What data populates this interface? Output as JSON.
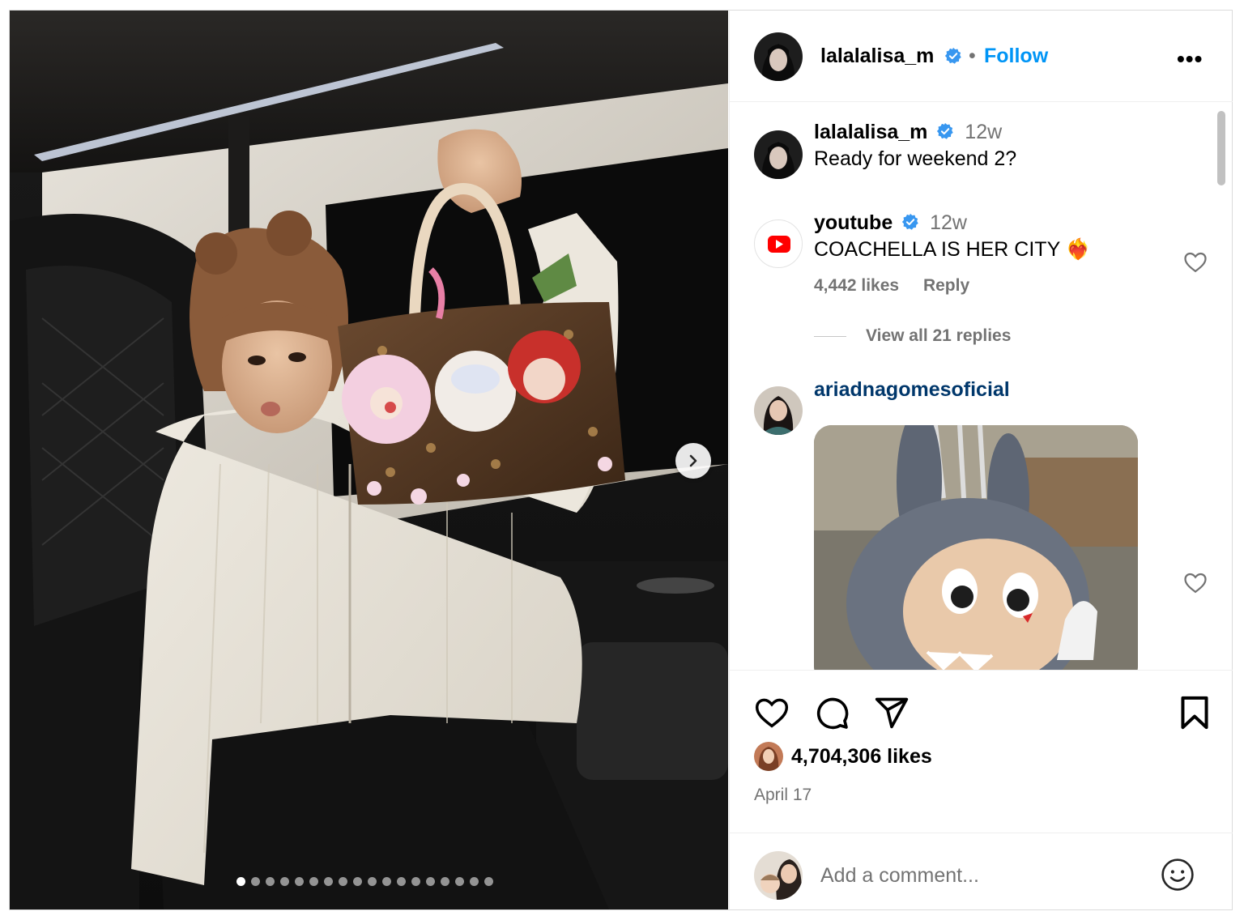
{
  "post": {
    "username": "lalalalisa_m",
    "follow_label": "Follow",
    "separator": "•",
    "more_label": "•••"
  },
  "media": {
    "slide_count": 18,
    "active_slide": 1
  },
  "comments": [
    {
      "username": "lalalalisa_m",
      "time": "12w",
      "text": "Ready for weekend 2?"
    },
    {
      "username": "youtube",
      "time": "12w",
      "text": "COACHELLA IS HER CITY ❤️‍🔥",
      "likes": "4,442 likes",
      "reply_label": "Reply",
      "view_replies": "View all 21 replies"
    },
    {
      "username": "ariadnagomesoficial"
    }
  ],
  "footer": {
    "likes": "4,704,306 likes",
    "date": "April 17",
    "comment_placeholder": "Add a comment..."
  },
  "colors": {
    "accent": "#0095f6",
    "verified": "#3897f0",
    "secondary_text": "#737373",
    "youtube_red": "#ff0000"
  },
  "icons": [
    "verified-badge-icon",
    "chevron-right-icon",
    "heart-icon",
    "comment-icon",
    "share-icon",
    "bookmark-icon",
    "emoji-icon",
    "youtube-logo-icon"
  ]
}
